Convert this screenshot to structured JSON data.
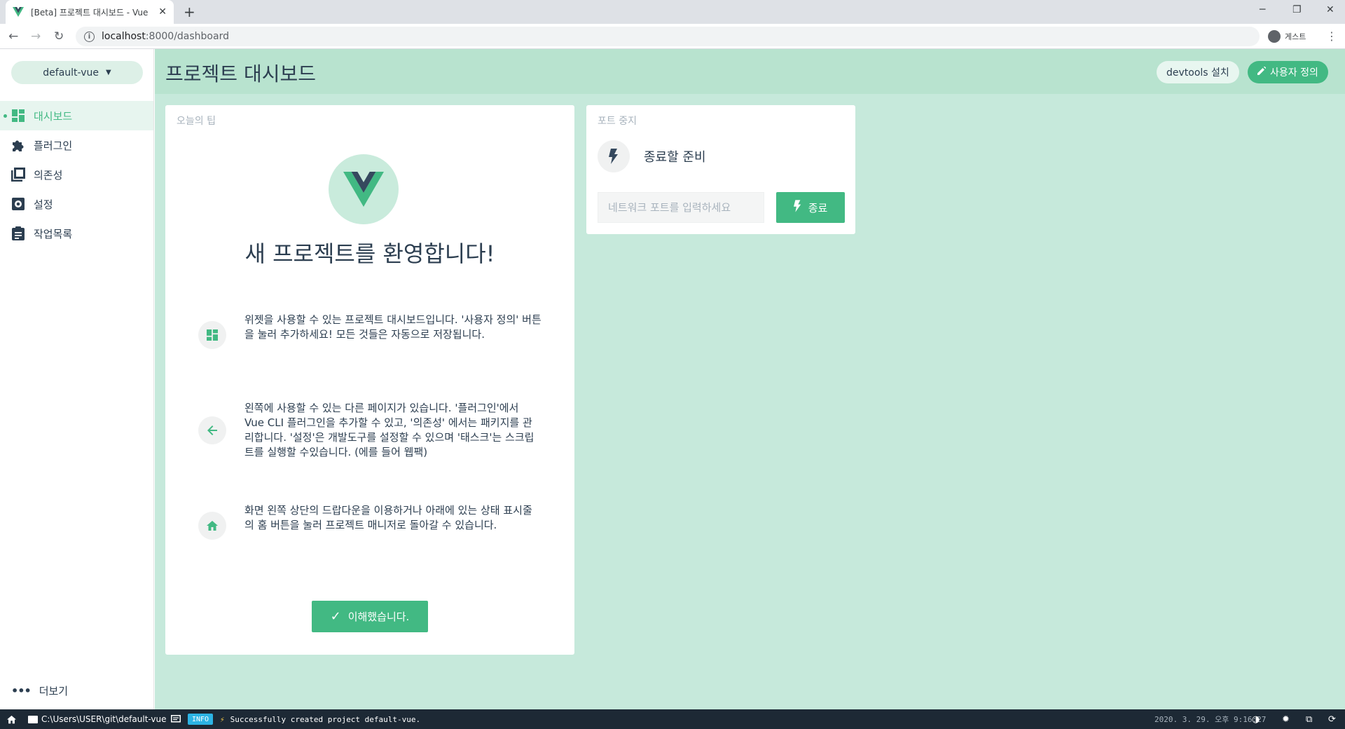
{
  "browser": {
    "tab_title": "[Beta] 프로젝트 대시보드 - Vue",
    "tab_close": "✕",
    "new_tab": "+",
    "url_host": "localhost",
    "url_path": ":8000/dashboard",
    "guest_label": "게스트",
    "icons": {
      "back": "←",
      "forward": "→",
      "reload": "↻",
      "menu": "⋮",
      "minimize": "─",
      "restore": "❐",
      "close": "✕",
      "info": "i"
    }
  },
  "sidebar": {
    "project": "default-vue",
    "items": [
      {
        "label": "대시보드",
        "icon": "dashboard-icon",
        "active": true
      },
      {
        "label": "플러그인",
        "icon": "puzzle-icon",
        "active": false
      },
      {
        "label": "의존성",
        "icon": "library-icon",
        "active": false
      },
      {
        "label": "설정",
        "icon": "gear-icon",
        "active": false
      },
      {
        "label": "작업목록",
        "icon": "clipboard-icon",
        "active": false
      }
    ],
    "more_label": "더보기"
  },
  "header": {
    "title": "프로젝트 대시보드",
    "devtools_label": "devtools 설치",
    "customize_label": "사용자 정의"
  },
  "tip_card": {
    "title": "오늘의 팁",
    "welcome": "새 프로젝트를 환영합니다!",
    "tips": [
      {
        "icon": "dashboard-icon",
        "text": "위젯을 사용할 수 있는 프로젝트 대시보드입니다. '사용자 정의' 버튼을 눌러 추가하세요! 모든 것들은 자동으로 저장됩니다."
      },
      {
        "icon": "arrow-left-icon",
        "text": "왼쪽에 사용할 수 있는 다른 페이지가 있습니다. '플러그인'에서 Vue CLI 플러그인을 추가할 수 있고, '의존성' 에서는 패키지를 관리합니다. '설정'은 개발도구를 설정할 수 있으며 '태스크'는 스크립트를 실행할 수있습니다. (에를 들어 웹팩)"
      },
      {
        "icon": "home-icon",
        "text": "화면 왼쪽 상단의 드랍다운을 이용하거나 아래에 있는 상태 표시줄의 홈 버튼을 눌러 프로젝트 매니저로 돌아갈 수 있습니다."
      }
    ],
    "ok_label": "이해했습니다."
  },
  "kill_card": {
    "title": "포트 중지",
    "status": "종료할 준비",
    "port_placeholder": "네트워크 포트를 입력하세요",
    "kill_label": "종료"
  },
  "statusbar": {
    "path": "C:\\Users\\USER\\git\\default-vue",
    "log_level": "INFO",
    "message": "Successfully created project default-vue.",
    "timestamp": "2020. 3. 29. 오후 9:16:27"
  },
  "colors": {
    "accent": "#42b983",
    "header_bg": "#b8e3cf",
    "content_bg": "#c6e9db",
    "statusbar_bg": "#1d2935",
    "vue_dark": "#35495e"
  }
}
